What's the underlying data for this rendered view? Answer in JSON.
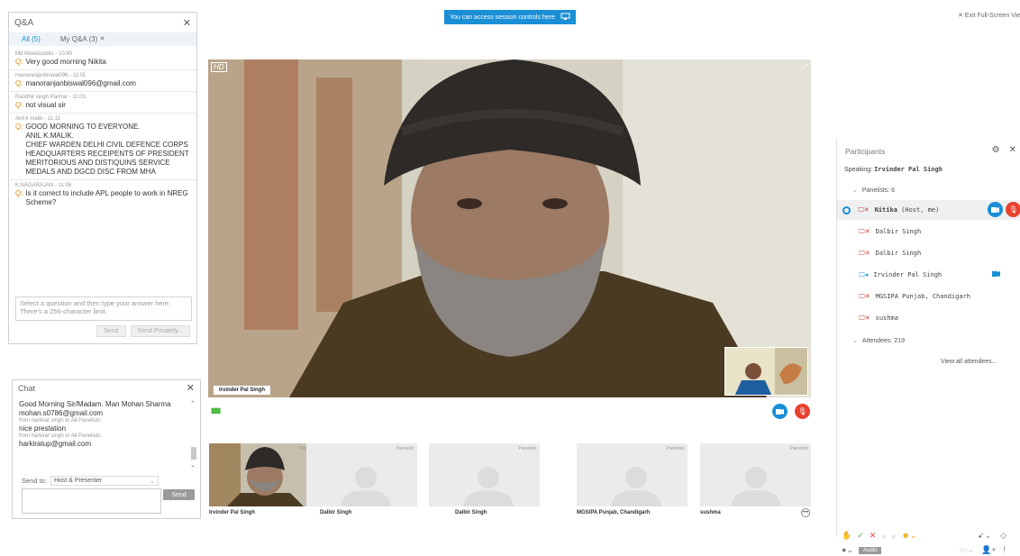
{
  "banner": {
    "text": "You can access session controls here"
  },
  "exit_fullscreen": "✕ Exit Full-Screen View",
  "qa": {
    "title": "Q&A",
    "tabs": [
      {
        "label": "All (5)"
      },
      {
        "label": "My Q&A (3)"
      }
    ],
    "items": [
      {
        "meta": "Md Moeezuddin - 10:45",
        "question": "Very good morning Nikita"
      },
      {
        "meta": "manoranjanbiswal096 - 11:01",
        "question": "manoranjanbiswal096@gmail.com"
      },
      {
        "meta": "Randhir singh Parihar - 11:03",
        "question": "not visual sir"
      },
      {
        "meta": "Anil k malik - 11:11",
        "question": "GOOD MORNING TO EVERYONE.\nANIL K.MALIK.\nCHIEF WARDEN DELHI CIVIL DEFENCE CORPS HEADQUARTERS RECEIPENTS OF PRESIDENT MERITORIOUS AND DISTIQUINS SERVICE MEDALS AND DGCD DISC FROM MHA"
      },
      {
        "meta": "K.NAGARAJAN - 11:06",
        "question": "Is it correct to include APL people to work in NREG Scheme?"
      }
    ],
    "answer_placeholder": "Select a question and then type your answer here. There's a 256-character limit.",
    "send_label": "Send",
    "send_privately_label": "Send Privately..."
  },
  "chat": {
    "title": "Chat",
    "messages": [
      {
        "meta": "",
        "text": "Good Morning Sir/Madam.    Man Mohan Sharma"
      },
      {
        "meta": "",
        "text": "mohan.s0786@gmail.com"
      },
      {
        "meta": "from harkirat singh to All Panelists:",
        "text": "nice prestation"
      },
      {
        "meta": "from harkirat singh to All Panelists:",
        "text": "harkiratup@gmail.com"
      }
    ],
    "send_to_label": "Send to:",
    "send_to_value": "Host & Presenter",
    "send_label": "Send"
  },
  "video": {
    "hd_badge": "HD",
    "speaker_label": "Irvinder Pal Singh"
  },
  "thumbnails": [
    {
      "name": "Irvinder Pal Singh",
      "role": "Panelist"
    },
    {
      "name": "Dalbir Singh",
      "role": "Panelist"
    },
    {
      "name": "Dalbir Singh",
      "role": "Panelist"
    },
    {
      "name": "MGSIPA Punjab, Chandigarh",
      "role": "Panelist"
    },
    {
      "name": "sushma",
      "role": "Panelist"
    }
  ],
  "participants": {
    "title": "Participants",
    "speaking_label": "Speaking:",
    "speaking_name": "Irvinder Pal Singh",
    "panelists_label": "Panelists: 6",
    "panelists": [
      {
        "name": "Nitika",
        "suffix": "(Host, me)"
      },
      {
        "name": "Dalbir Singh",
        "suffix": ""
      },
      {
        "name": "Dalbir Singh",
        "suffix": ""
      },
      {
        "name": "Irvinder Pal Singh",
        "suffix": ""
      },
      {
        "name": "MGSIPA Punjab, Chandigarh",
        "suffix": ""
      },
      {
        "name": "sushma",
        "suffix": ""
      }
    ],
    "attendees_label": "Attendees: 219",
    "view_all": "View all attendees..."
  },
  "toolbar": {
    "audio_label": "Audio"
  },
  "colors": {
    "accent": "#1a8fd5",
    "danger": "#e8412e",
    "question_mark": "#e08a1a",
    "audio_level": "#49b83b"
  }
}
